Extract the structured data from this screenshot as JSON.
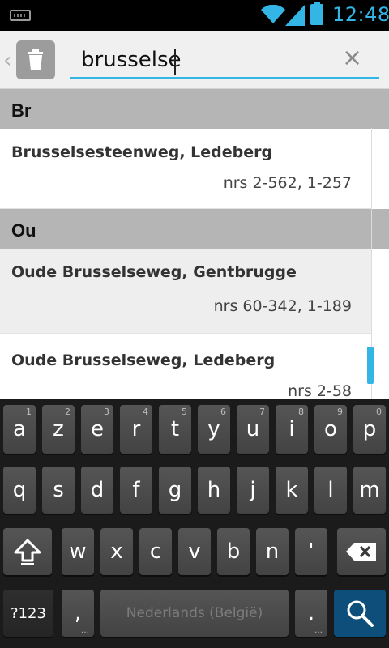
{
  "statusbar": {
    "time": "12:48",
    "accent": "#33b5e5"
  },
  "search": {
    "query": "brusselse",
    "clear_icon": "×",
    "back_icon": "‹"
  },
  "sections": [
    {
      "header": "Br"
    },
    {
      "header": "Ou"
    }
  ],
  "items": [
    {
      "title": "Brusselsesteenweg, Ledeberg",
      "numbers": "nrs 2-562, 1-257"
    },
    {
      "title": "Oude Brusselseweg, Gentbrugge",
      "numbers": "nrs 60-342, 1-189"
    },
    {
      "title": "Oude Brusselseweg, Ledeberg",
      "numbers": "nrs 2-58"
    }
  ],
  "keyboard": {
    "row1": [
      {
        "k": "a",
        "n": "1"
      },
      {
        "k": "z",
        "n": "2"
      },
      {
        "k": "e",
        "n": "3"
      },
      {
        "k": "r",
        "n": "4"
      },
      {
        "k": "t",
        "n": "5"
      },
      {
        "k": "y",
        "n": "6"
      },
      {
        "k": "u",
        "n": "7"
      },
      {
        "k": "i",
        "n": "8"
      },
      {
        "k": "o",
        "n": "9"
      },
      {
        "k": "p",
        "n": "0"
      }
    ],
    "row2": [
      "q",
      "s",
      "d",
      "f",
      "g",
      "h",
      "j",
      "k",
      "l",
      "m"
    ],
    "row3": [
      "w",
      "x",
      "c",
      "v",
      "b",
      "n",
      "'"
    ],
    "symbols_label": "?123",
    "comma": ",",
    "period": ".",
    "space_label": "Nederlands (België)",
    "more_dots": "…"
  }
}
